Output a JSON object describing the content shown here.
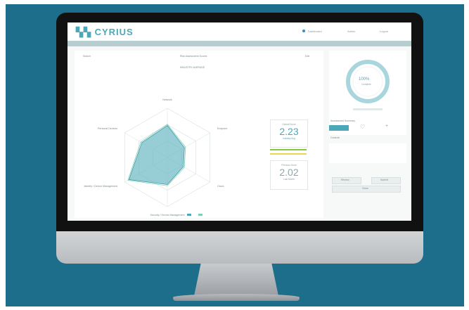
{
  "app": {
    "name": "CYRIUS"
  },
  "topbar": {
    "items": [
      "Dashboard",
      "Admin",
      "Logout"
    ]
  },
  "chart_panel": {
    "search_label": "Search",
    "dropdown": "Risk Assessment Scores",
    "edit_label": "Edit",
    "title": "INDUSTRY AVERAGE",
    "axes": [
      "Network",
      "Endpoint",
      "Cloud",
      "Security / Device Management",
      "Identity / Device Management",
      "Personal Devices"
    ]
  },
  "scores": {
    "top_label": "Overall Score",
    "top_value": "2.23",
    "top_sub": "Industry Avg",
    "bottom_label": "Previous Score",
    "bottom_value": "2.02",
    "bottom_sub": "Last Month"
  },
  "ring": {
    "percent": "100%",
    "sub": "Complete"
  },
  "right_panel": {
    "summary_label": "Assessment Summary",
    "section_label": "Controls",
    "btn_a": "Review",
    "btn_b": "Submit",
    "btn_c": "Close"
  },
  "chart_data": {
    "type": "radar",
    "axes": [
      "Network",
      "Endpoint",
      "Cloud",
      "Security / Device Management",
      "Identity / Device Management",
      "Personal Devices"
    ],
    "series": [
      {
        "values": [
          2.6,
          1.6,
          1.5,
          2.2,
          3.6,
          2.4
        ]
      },
      {
        "values": [
          2.7,
          1.7,
          1.6,
          2.3,
          3.7,
          2.5
        ]
      }
    ],
    "rlim": [
      0,
      4
    ],
    "grid": true
  },
  "colors": {
    "accent": "#4aa8b8",
    "fill": "#5fb3bf",
    "background": "#1c6e8a"
  }
}
